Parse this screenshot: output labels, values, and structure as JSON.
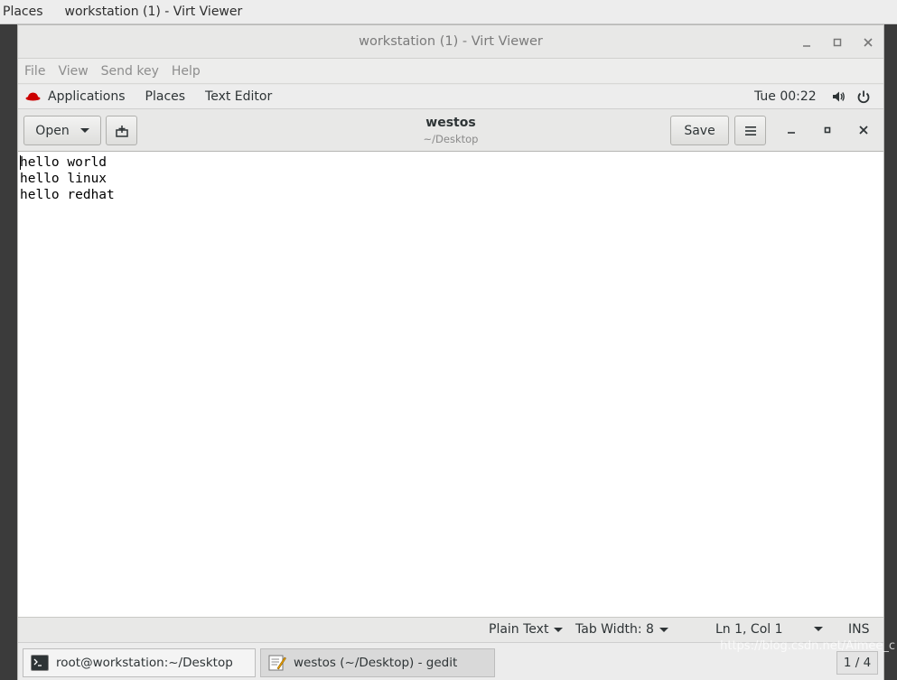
{
  "host_panel": {
    "places": "Places",
    "window_title": "workstation (1) - Virt Viewer"
  },
  "viewer": {
    "title": "workstation (1) - Virt Viewer",
    "menu": [
      "File",
      "View",
      "Send key",
      "Help"
    ]
  },
  "gnome_bar": {
    "applications": "Applications",
    "places": "Places",
    "app_name": "Text Editor",
    "clock": "Tue 00:22"
  },
  "gedit": {
    "open_label": "Open",
    "save_label": "Save",
    "doc_title": "westos",
    "doc_path": "~/Desktop",
    "lines": [
      "hello world",
      "hello linux",
      "hello redhat"
    ]
  },
  "statusbar": {
    "syntax": "Plain Text",
    "tab_width": "Tab Width: 8",
    "position": "Ln 1, Col 1",
    "mode": "INS"
  },
  "taskbar": {
    "tasks": [
      "root@workstation:~/Desktop",
      "westos (~/Desktop) - gedit"
    ],
    "pager": "1 / 4"
  },
  "watermark": "https://blog.csdn.net/Aimee_c",
  "colors": {
    "redhat_red": "#cc0000",
    "accent": "#2e3436"
  }
}
